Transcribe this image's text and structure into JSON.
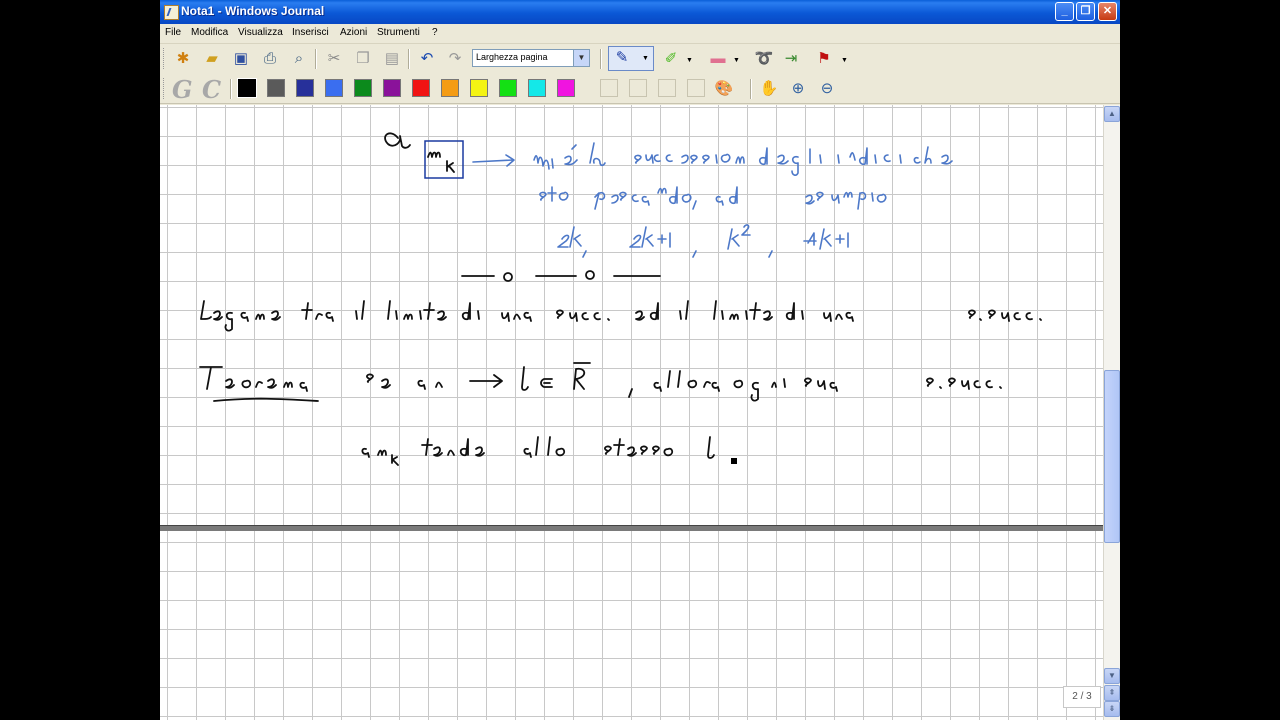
{
  "window": {
    "title": "Nota1 - Windows Journal"
  },
  "menu": [
    "File",
    "Modifica",
    "Visualizza",
    "Inserisci",
    "Azioni",
    "Strumenti",
    "?"
  ],
  "toolbar": {
    "icons": [
      "new-note-icon",
      "open-icon",
      "save-icon",
      "print-icon",
      "find-icon",
      "cut-icon",
      "copy-icon",
      "paste-icon",
      "undo-icon",
      "redo-icon"
    ],
    "page_width": "Larghezza pagina",
    "tools": [
      "pen-icon",
      "highlighter-icon",
      "eraser-icon",
      "lasso-icon",
      "insert-space-icon",
      "flag-icon"
    ]
  },
  "format_toolbar": {
    "letters": [
      "G",
      "C"
    ],
    "colors": [
      "#000000",
      "#5a5a5a",
      "#27309a",
      "#3a6ef0",
      "#0c8a1c",
      "#8a129a",
      "#f01414",
      "#f49c14",
      "#f4f414",
      "#14e014",
      "#14e8e8",
      "#f014e0"
    ]
  },
  "document": {
    "page_indicator": "2 / 3",
    "handwriting": [
      "a nk → nk è la successione degli indici che sto pescando, ad esempio",
      "2k , 2k+1 , k² , 4k+1",
      "Legame tra il limite di una succ. ed il limite di una s.succ.",
      "Teorema  Se an → l ∈ R̄ , allora ogni sua s.succ.",
      "ank tende allo stesso l."
    ]
  }
}
